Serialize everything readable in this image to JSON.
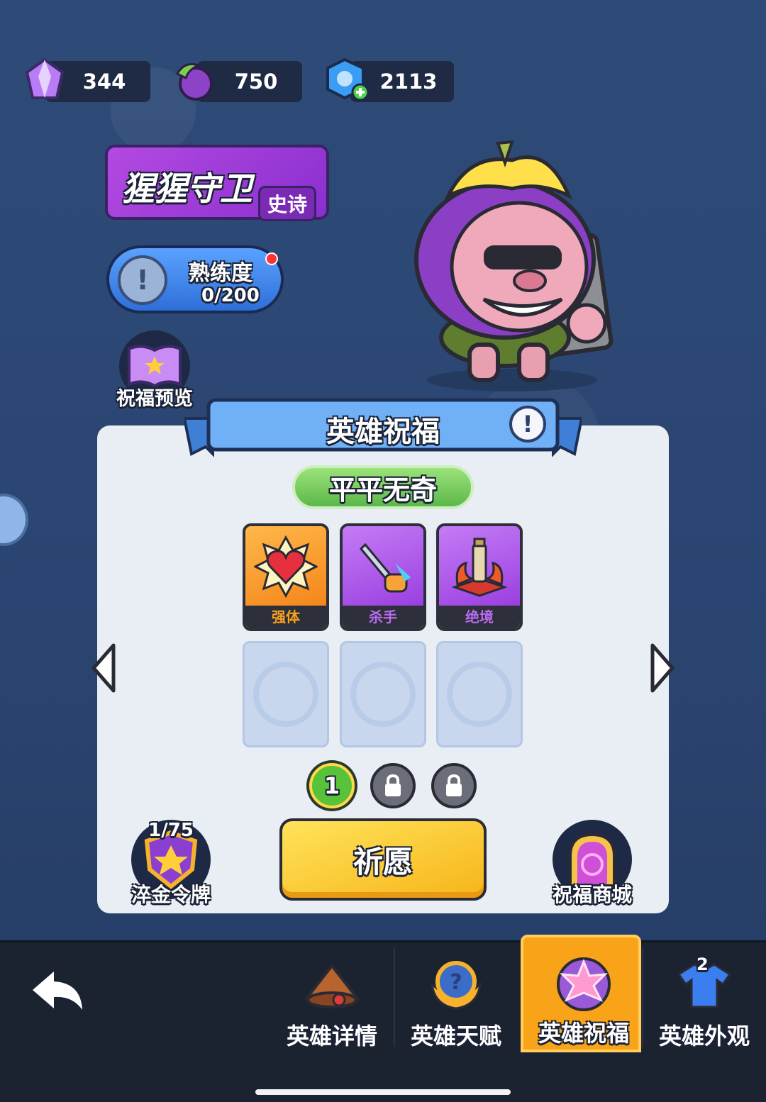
{
  "currencies": [
    {
      "id": "gem",
      "value": "344",
      "icon": "purple-crystal-icon"
    },
    {
      "id": "seed",
      "value": "750",
      "icon": "purple-seed-icon"
    },
    {
      "id": "energy",
      "value": "2113",
      "icon": "blue-energy-add-icon"
    }
  ],
  "hero": {
    "name": "猩猩守卫",
    "rarity": "史诗",
    "mastery_label": "熟练度",
    "mastery_value": "0/200"
  },
  "blessing_preview_label": "祝福预览",
  "blessing_panel": {
    "title": "英雄祝福",
    "quality": "平平无奇",
    "cards": [
      {
        "label": "强体",
        "icon": "heart-burst-icon",
        "color": "#f7a21c",
        "text_color": "#f7a21c"
      },
      {
        "label": "杀手",
        "icon": "sword-fist-icon",
        "color": "#a64fe6",
        "text_color": "#b96af0"
      },
      {
        "label": "绝境",
        "icon": "flame-pillar-icon",
        "color": "#a64fe6",
        "text_color": "#b96af0"
      }
    ],
    "pages": [
      {
        "label": "1",
        "state": "active"
      },
      {
        "label": "",
        "state": "locked"
      },
      {
        "label": "",
        "state": "locked"
      }
    ],
    "pray_label": "祈愿",
    "token": {
      "count": "1/75",
      "label": "淬金令牌"
    },
    "shop_label": "祝福商城"
  },
  "nav": {
    "tabs": [
      {
        "label": "英雄详情",
        "icon": "hero-hat-icon",
        "active": false
      },
      {
        "label": "英雄天赋",
        "icon": "talent-medal-icon",
        "active": false
      },
      {
        "label": "英雄祝福",
        "icon": "blessing-star-icon",
        "active": true
      },
      {
        "label": "英雄外观",
        "icon": "tshirt-icon",
        "active": false,
        "badge": "2"
      }
    ]
  },
  "colors": {
    "accent": "#f9a318",
    "panel": "#e9edf4",
    "epic": "#9b3ddb"
  }
}
